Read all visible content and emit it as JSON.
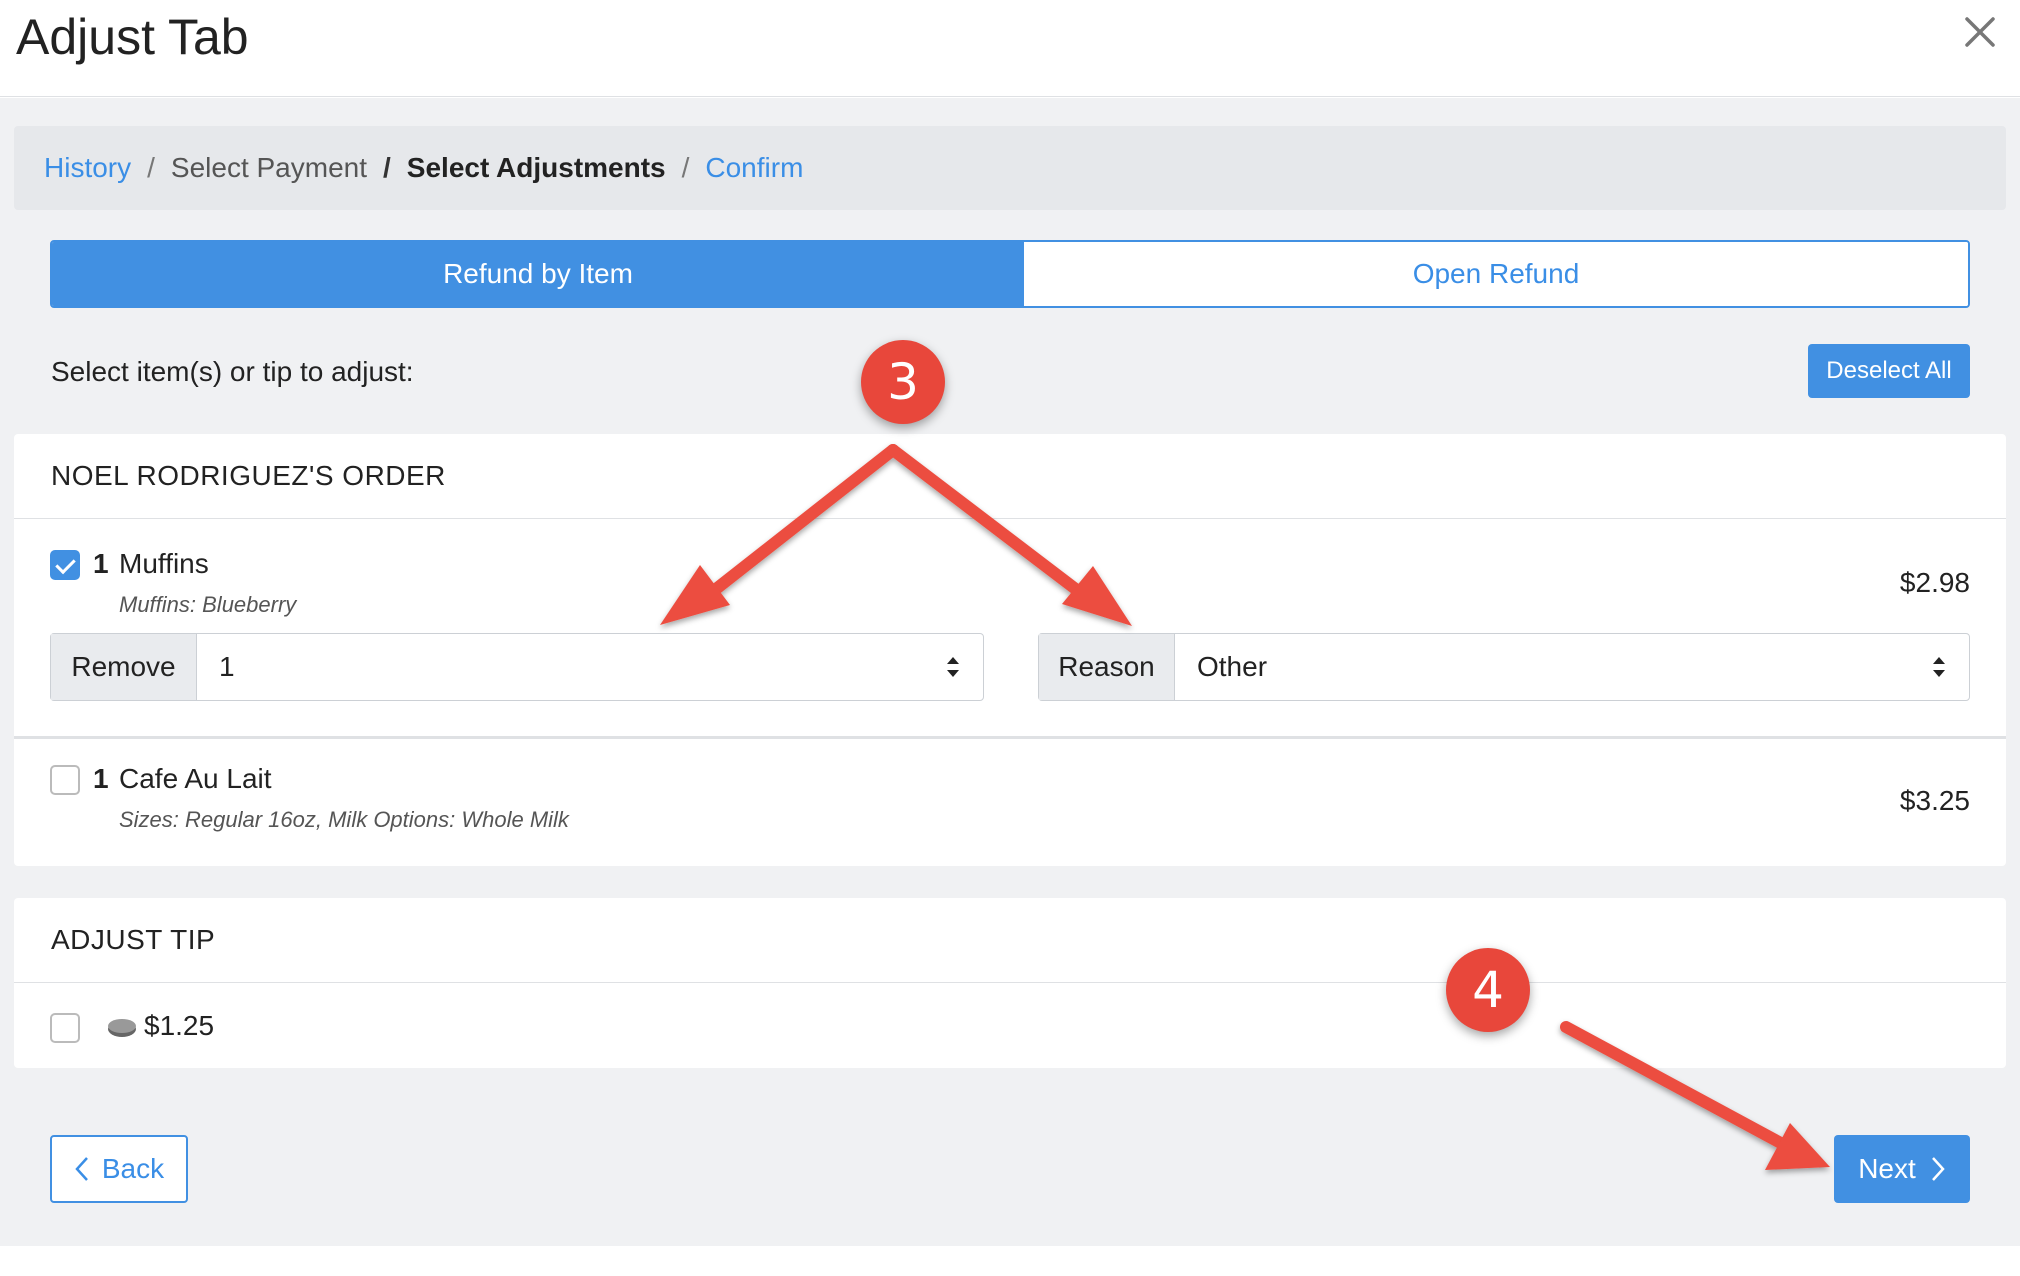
{
  "header": {
    "title": "Adjust Tab",
    "close_icon": "close-icon"
  },
  "breadcrumb": {
    "items": [
      "History",
      "Select Payment",
      "Select Adjustments",
      "Confirm"
    ],
    "separator": "/"
  },
  "tabs": [
    {
      "label": "Refund by Item",
      "active": true
    },
    {
      "label": "Open Refund",
      "active": false
    }
  ],
  "prompt": "Select item(s) or tip to adjust:",
  "deselect_label": "Deselect All",
  "order": {
    "header": "NOEL RODRIGUEZ'S ORDER",
    "items": [
      {
        "qty": "1",
        "name": "Muffins",
        "modifiers": "Muffins: Blueberry",
        "price": "$2.98",
        "checked": true,
        "remove_label": "Remove",
        "remove_value": "1",
        "reason_label": "Reason",
        "reason_value": "Other"
      },
      {
        "qty": "1",
        "name": "Cafe Au Lait",
        "modifiers": "Sizes: Regular 16oz, Milk Options: Whole Milk",
        "price": "$3.25",
        "checked": false
      }
    ]
  },
  "tip": {
    "header": "ADJUST TIP",
    "amount": "$1.25",
    "checked": false,
    "icon": "coin-icon"
  },
  "footer": {
    "back_label": "Back",
    "next_label": "Next"
  },
  "annotations": {
    "badge_3": "3",
    "badge_4": "4"
  },
  "colors": {
    "accent": "#4190e2",
    "annotation": "#e8473b",
    "background": "#f0f1f3"
  }
}
